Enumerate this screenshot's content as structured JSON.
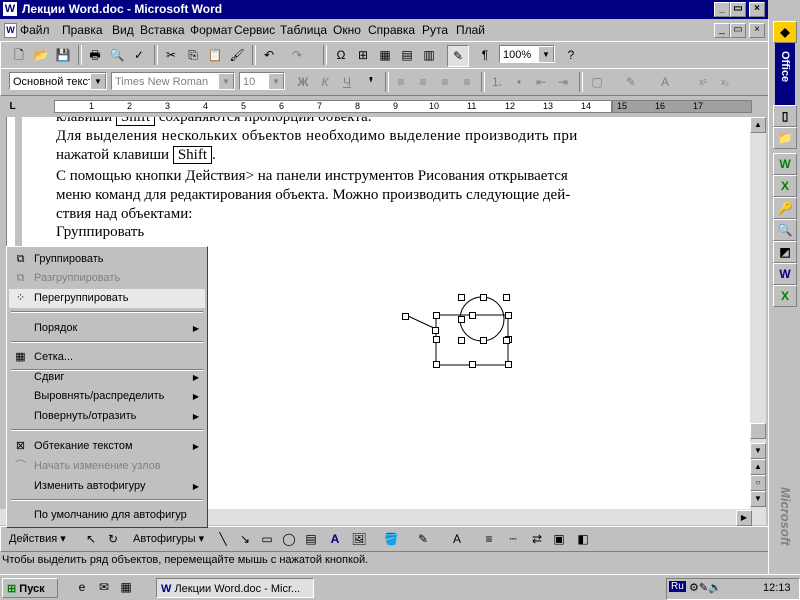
{
  "window": {
    "title": "Лекции Word.doc - Microsoft Word",
    "controls": [
      "_",
      "▭",
      "×"
    ]
  },
  "menubar": {
    "items": [
      "Файл",
      "Правка",
      "Вид",
      "Вставка",
      "Формат",
      "Сервис",
      "Таблица",
      "Окно",
      "Справка",
      "Рута",
      "Плай"
    ]
  },
  "standard_toolbar": {
    "zoom": "100%"
  },
  "formatting_toolbar": {
    "style": "Основной текст",
    "font": "Times New Roman",
    "size": "10",
    "bold": "Ж",
    "italic": "К",
    "underline": "Ч"
  },
  "ruler": {
    "numbers": [
      "1",
      "2",
      "3",
      "4",
      "5",
      "6",
      "7",
      "8",
      "9",
      "10",
      "11",
      "12",
      "13",
      "14",
      "15",
      "16",
      "17"
    ]
  },
  "document": {
    "lines": [
      "клавиши",
      "Для выделения нескольких объектов необходимо выделение производить при",
      "нажатой клавиши",
      "С помощью кнопки Действия> на панели инструментов Рисования открывается",
      "меню команд для редактирования объекта. Можно производить следующие дей-",
      "ствия над объектами:",
      "Группировать"
    ],
    "partial_first_tail": "сохраняются пропорции объекта.",
    "key_shift": "Shift"
  },
  "context_menu": {
    "items": [
      {
        "label": "Группировать",
        "disabled": false,
        "submenu": false
      },
      {
        "label": "Разгруппировать",
        "disabled": true,
        "submenu": false
      },
      {
        "label": "Перегруппировать",
        "disabled": false,
        "submenu": false
      },
      {
        "label": "Порядок",
        "disabled": false,
        "submenu": true
      },
      {
        "label": "Сетка...",
        "disabled": false,
        "submenu": false
      },
      {
        "label": "Сдвиг",
        "disabled": false,
        "submenu": true
      },
      {
        "label": "Выровнять/распределить",
        "disabled": false,
        "submenu": true
      },
      {
        "label": "Повернуть/отразить",
        "disabled": false,
        "submenu": true
      },
      {
        "label": "Обтекание текстом",
        "disabled": false,
        "submenu": true
      },
      {
        "label": "Начать изменение узлов",
        "disabled": true,
        "submenu": false
      },
      {
        "label": "Изменить автофигуру",
        "disabled": false,
        "submenu": true
      },
      {
        "label": "По умолчанию для автофигур",
        "disabled": false,
        "submenu": false
      }
    ]
  },
  "drawing_toolbar": {
    "actions": "Действия",
    "autoshapes": "Автофигуры"
  },
  "statusbar": {
    "text": "Чтобы выделить ряд объектов, перемещайте мышь с нажатой кнопкой."
  },
  "taskbar": {
    "start": "Пуск",
    "task": "Лекции Word.doc - Micr...",
    "lang": "Ru",
    "clock": "12:13"
  },
  "officebar": {
    "label": "Office",
    "bottom": "Microsoft"
  }
}
